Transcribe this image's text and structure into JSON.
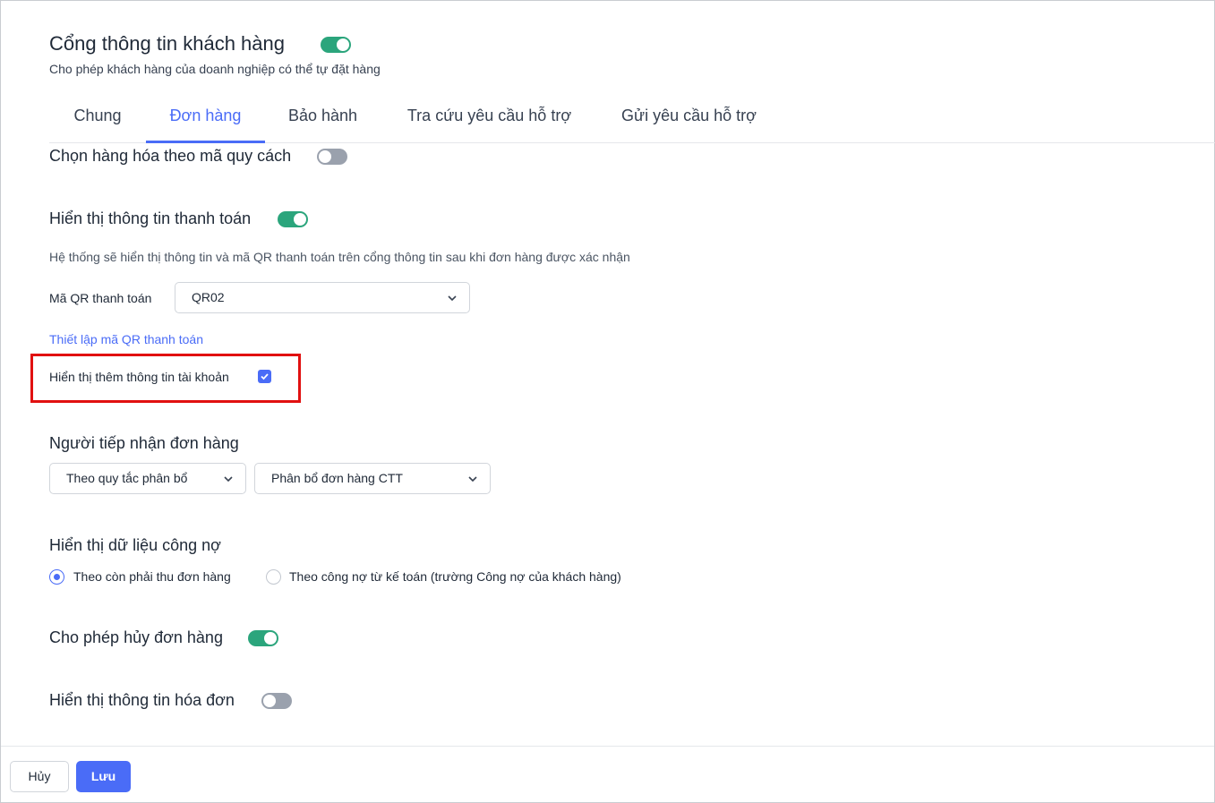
{
  "header": {
    "title": "Cổng thông tin khách hàng",
    "subtitle": "Cho phép khách hàng của doanh nghiệp có thể tự đặt hàng",
    "enabled": true
  },
  "tabs": [
    {
      "label": "Chung",
      "active": false
    },
    {
      "label": "Đơn hàng",
      "active": true
    },
    {
      "label": "Bảo hành",
      "active": false
    },
    {
      "label": "Tra cứu yêu cầu hỗ trợ",
      "active": false
    },
    {
      "label": "Gửi yêu cầu hỗ trợ",
      "active": false
    }
  ],
  "settings": {
    "spec_code": {
      "label": "Chọn hàng hóa theo mã quy cách",
      "enabled": false
    },
    "payment_info": {
      "label": "Hiển thị thông tin thanh toán",
      "enabled": true,
      "description": "Hệ thống sẽ hiển thị thông tin và mã QR thanh toán trên cổng thông tin sau khi đơn hàng được xác nhận",
      "qr_label": "Mã QR thanh toán",
      "qr_value": "QR02",
      "setup_link": "Thiết lập mã QR thanh toán",
      "account_info_label": "Hiển thị thêm thông tin tài khoản",
      "account_info_checked": true
    },
    "receiver": {
      "label": "Người tiếp nhận đơn hàng",
      "rule_value": "Theo quy tắc phân bổ",
      "allocation_value": "Phân bổ đơn hàng CTT"
    },
    "debt": {
      "label": "Hiển thị dữ liệu công nợ",
      "options": [
        {
          "label": "Theo còn phải thu đơn hàng",
          "selected": true
        },
        {
          "label": "Theo công nợ từ kế toán (trường Công nợ của khách hàng)",
          "selected": false
        }
      ]
    },
    "cancel_order": {
      "label": "Cho phép hủy đơn hàng",
      "enabled": true
    },
    "invoice_info": {
      "label": "Hiển thị thông tin hóa đơn",
      "enabled": false
    }
  },
  "footer": {
    "cancel_label": "Hủy",
    "save_label": "Lưu"
  },
  "colors": {
    "accent": "#4a6cf7",
    "toggle_on": "#2ba57c",
    "toggle_off": "#9aa1ad",
    "highlight": "#e11010"
  }
}
